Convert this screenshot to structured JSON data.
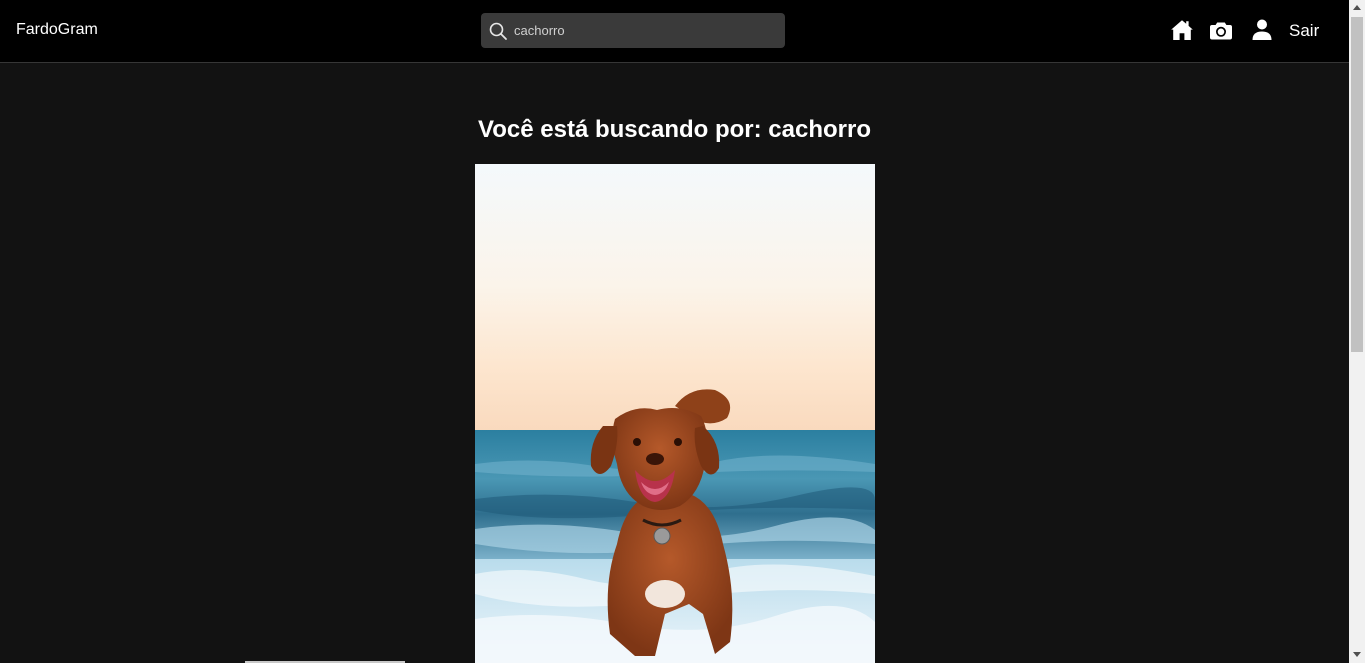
{
  "navbar": {
    "brand": "FardoGram",
    "search": {
      "value": "cachorro",
      "icon": "search-icon"
    },
    "icons": [
      "home-icon",
      "camera-icon",
      "user-icon"
    ],
    "logout_label": "Sair"
  },
  "main": {
    "title": "Você está buscando por: cachorro",
    "photo_alt": "cachorro"
  },
  "colors": {
    "navbar_bg": "#000000",
    "page_bg": "#121212",
    "search_bg": "#3a3a3a",
    "text": "#ffffff"
  }
}
